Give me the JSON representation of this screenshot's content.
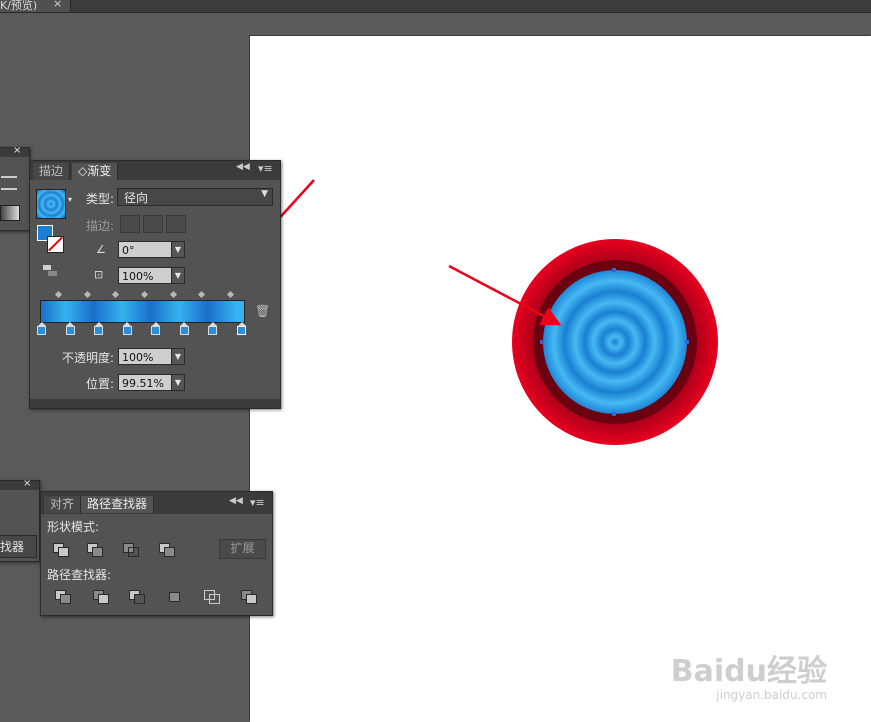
{
  "doc_tab": {
    "title": "K/预览)",
    "close": "×"
  },
  "gradient_panel": {
    "tabs": [
      "描边",
      "渐变"
    ],
    "active_tab": "渐变",
    "type_label": "类型:",
    "type_value": "径向",
    "stroke_label": "描边:",
    "angle_value": "0°",
    "aspect_value": "100%",
    "opacity_label": "不透明度:",
    "opacity_value": "100%",
    "position_label": "位置:",
    "position_value": "99.51%",
    "stop_count": 8,
    "midpoint_count": 7,
    "gradient_colors": [
      "#1a6fc9",
      "#35b2ef"
    ]
  },
  "pathfinder_panel": {
    "tabs": [
      "对齐",
      "路径查找器"
    ],
    "active_tab": "路径查找器",
    "shape_modes_label": "形状模式:",
    "expand_label": "扩展",
    "pathfinders_label": "路径查找器:",
    "side_label": "找器"
  },
  "canvas": {
    "outer_ring_color": "#e0001e",
    "inner_ring_color": "#6b0010",
    "fill_gradient": [
      "#1b82d6",
      "#42b6f2"
    ]
  },
  "annotation": {
    "arrow_color": "#f0001a"
  },
  "watermark": {
    "brand": "Baidu经验",
    "url": "jingyan.baidu.com"
  }
}
